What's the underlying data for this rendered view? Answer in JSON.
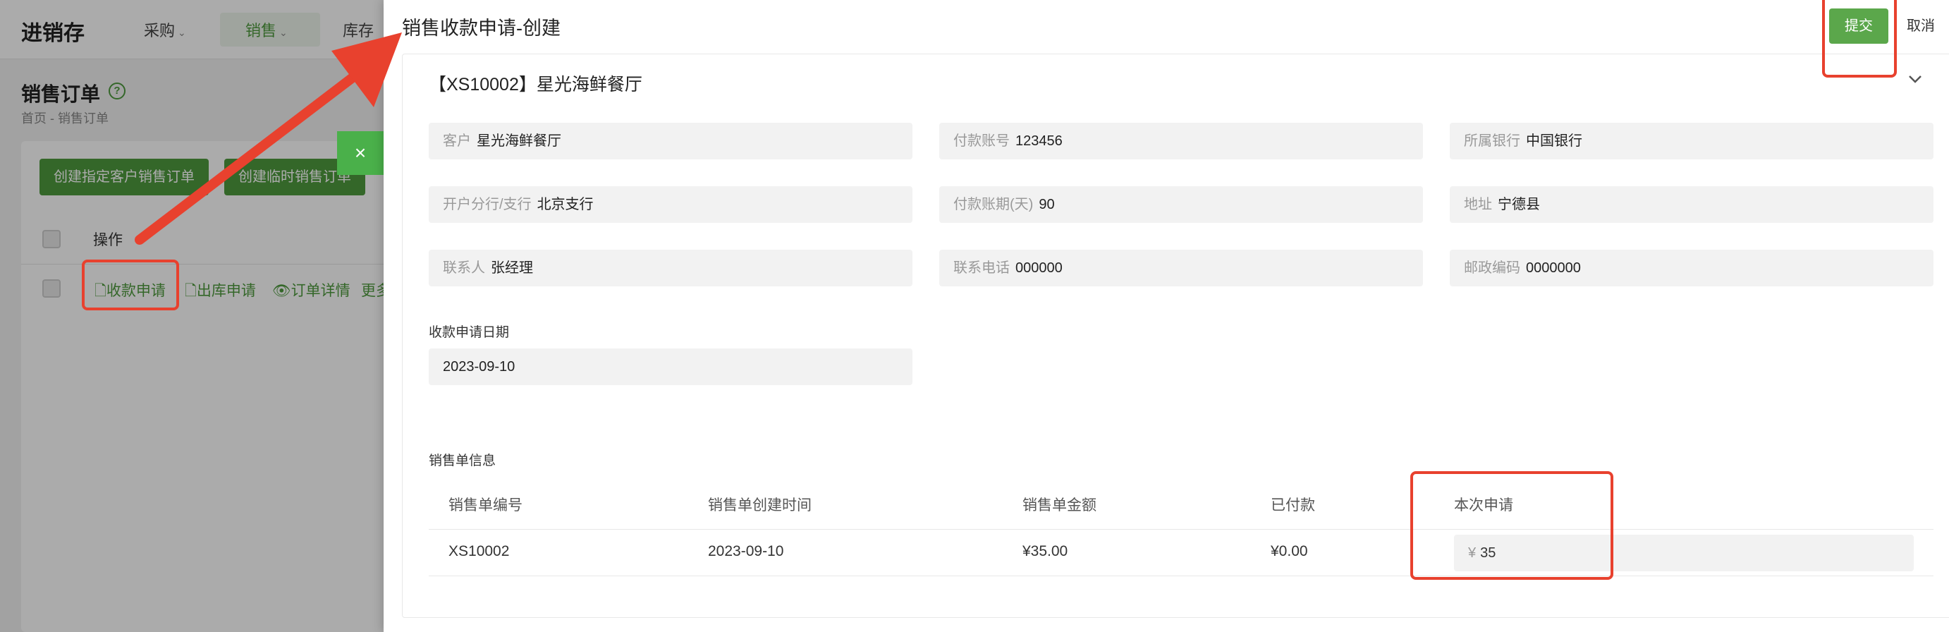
{
  "app": {
    "logo": "进销存",
    "nav": [
      {
        "label": "采购"
      },
      {
        "label": "销售"
      },
      {
        "label": "库存"
      }
    ],
    "page_title": "销售订单",
    "breadcrumb": "首页 - 销售订单",
    "buttons": {
      "create_customer_order": "创建指定客户销售订单",
      "create_temp_order": "创建临时销售订单"
    },
    "close_glyph": "×",
    "table": {
      "header_op": "操作",
      "row_actions": {
        "receipt": "收款申请",
        "outbound": "出库申请",
        "detail": "订单详情",
        "more": "更多"
      }
    }
  },
  "drawer": {
    "title": "销售收款申请-创建",
    "submit": "提交",
    "cancel": "取消",
    "section_title": "【XS10002】星光海鲜餐厅",
    "fields": {
      "customer": {
        "label": "客户",
        "value": "星光海鲜餐厅"
      },
      "account": {
        "label": "付款账号",
        "value": "123456"
      },
      "bank": {
        "label": "所属银行",
        "value": "中国银行"
      },
      "branch": {
        "label": "开户分行/支行",
        "value": "北京支行"
      },
      "term": {
        "label": "付款账期(天)",
        "value": "90"
      },
      "address": {
        "label": "地址",
        "value": "宁德县"
      },
      "contact": {
        "label": "联系人",
        "value": "张经理"
      },
      "phone": {
        "label": "联系电话",
        "value": "000000"
      },
      "postcode": {
        "label": "邮政编码",
        "value": "0000000"
      }
    },
    "date_label": "收款申请日期",
    "date_value": "2023-09-10",
    "order_info_label": "销售单信息",
    "order_table": {
      "headers": [
        "销售单编号",
        "销售单创建时间",
        "销售单金额",
        "已付款",
        "本次申请"
      ],
      "row": {
        "order_no": "XS10002",
        "created": "2023-09-10",
        "amount": "¥35.00",
        "paid": "¥0.00",
        "currency": "¥",
        "apply": "35"
      }
    }
  }
}
